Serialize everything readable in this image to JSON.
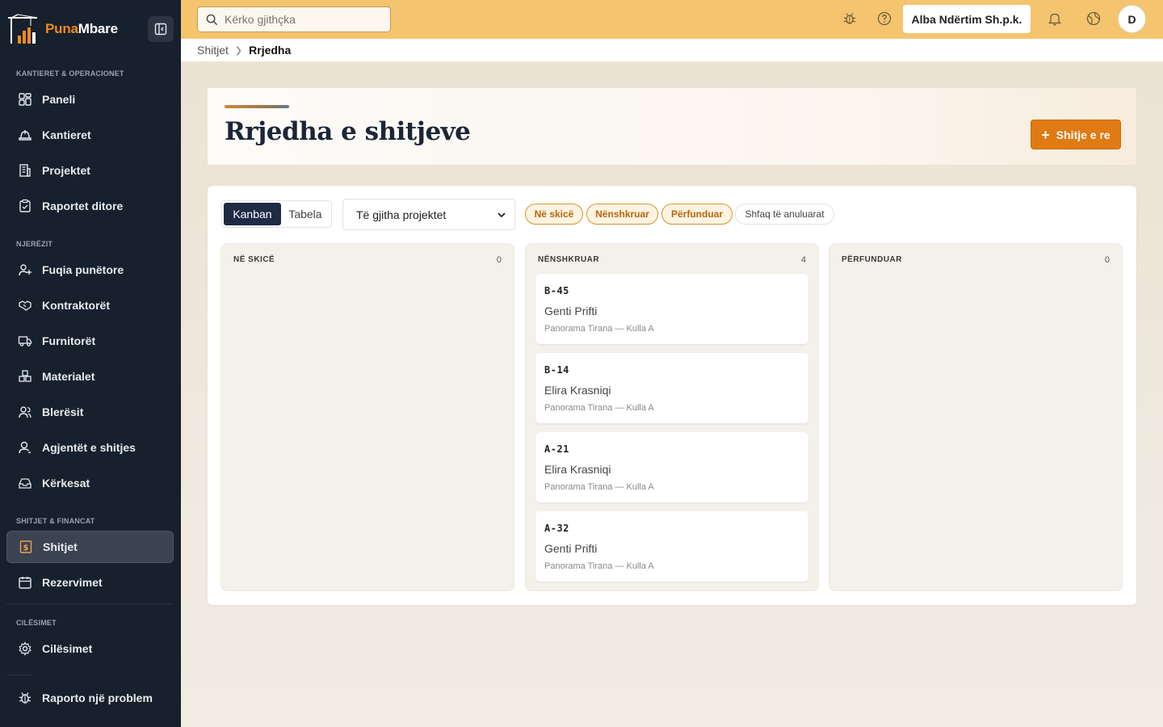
{
  "app": {
    "logo_part1": "Puna",
    "logo_part2": "Mbare"
  },
  "sidebar": {
    "sections": [
      {
        "label": "KANTIERET & OPERACIONET"
      },
      {
        "label": "NJERËZIT"
      },
      {
        "label": "SHITJET & FINANCAT"
      },
      {
        "label": "CILËSIMET"
      }
    ],
    "items": [
      {
        "label": "Paneli",
        "icon": "dashboard-icon"
      },
      {
        "label": "Kantieret",
        "icon": "hardhat-icon"
      },
      {
        "label": "Projektet",
        "icon": "building-icon"
      },
      {
        "label": "Raportet ditore",
        "icon": "clipboard-icon"
      },
      {
        "label": "Fuqia punëtore",
        "icon": "user-plus-icon"
      },
      {
        "label": "Kontraktorët",
        "icon": "handshake-icon"
      },
      {
        "label": "Furnitorët",
        "icon": "truck-icon"
      },
      {
        "label": "Materialet",
        "icon": "boxes-icon"
      },
      {
        "label": "Blerësit",
        "icon": "users-icon"
      },
      {
        "label": "Agjentët e shitjes",
        "icon": "user-icon"
      },
      {
        "label": "Kërkesat",
        "icon": "inbox-icon"
      },
      {
        "label": "Shitjet",
        "icon": "dollar-doc-icon",
        "active": true
      },
      {
        "label": "Rezervimet",
        "icon": "calendar-icon"
      },
      {
        "label": "Cilësimet",
        "icon": "gear-icon"
      },
      {
        "label": "Raporto një problem",
        "icon": "bug-icon"
      }
    ]
  },
  "topbar": {
    "search_placeholder": "Kërko gjithçka",
    "company": "Alba Ndërtim Sh.p.k.",
    "avatar_initial": "D"
  },
  "breadcrumb": {
    "items": [
      "Shitjet",
      "Rrjedha"
    ]
  },
  "page": {
    "title": "Rrjedha e shitjeve",
    "new_button": "Shitje e re"
  },
  "toolbar": {
    "view_options": [
      "Kanban",
      "Tabela"
    ],
    "active_view": "Kanban",
    "project_filter": "Të gjitha projektet",
    "status_chips": [
      "Në skicë",
      "Nënshkruar",
      "Përfunduar"
    ],
    "show_cancelled": "Shfaq të anuluarat"
  },
  "colors": {
    "accent": "#e07a12",
    "topbar": "#f4c46f",
    "sidebar": "#17202d"
  },
  "columns": [
    {
      "title": "NË SKICË",
      "count": "0",
      "cards": []
    },
    {
      "title": "NËNSHKRUAR",
      "count": "4",
      "cards": [
        {
          "code": "B-45",
          "buyer": "Genti Prifti",
          "project": "Panorama Tirana — Kulla A"
        },
        {
          "code": "B-14",
          "buyer": "Elira Krasniqi",
          "project": "Panorama Tirana — Kulla A"
        },
        {
          "code": "A-21",
          "buyer": "Elira Krasniqi",
          "project": "Panorama Tirana — Kulla A"
        },
        {
          "code": "A-32",
          "buyer": "Genti Prifti",
          "project": "Panorama Tirana — Kulla A"
        }
      ]
    },
    {
      "title": "PËRFUNDUAR",
      "count": "0",
      "cards": []
    }
  ]
}
